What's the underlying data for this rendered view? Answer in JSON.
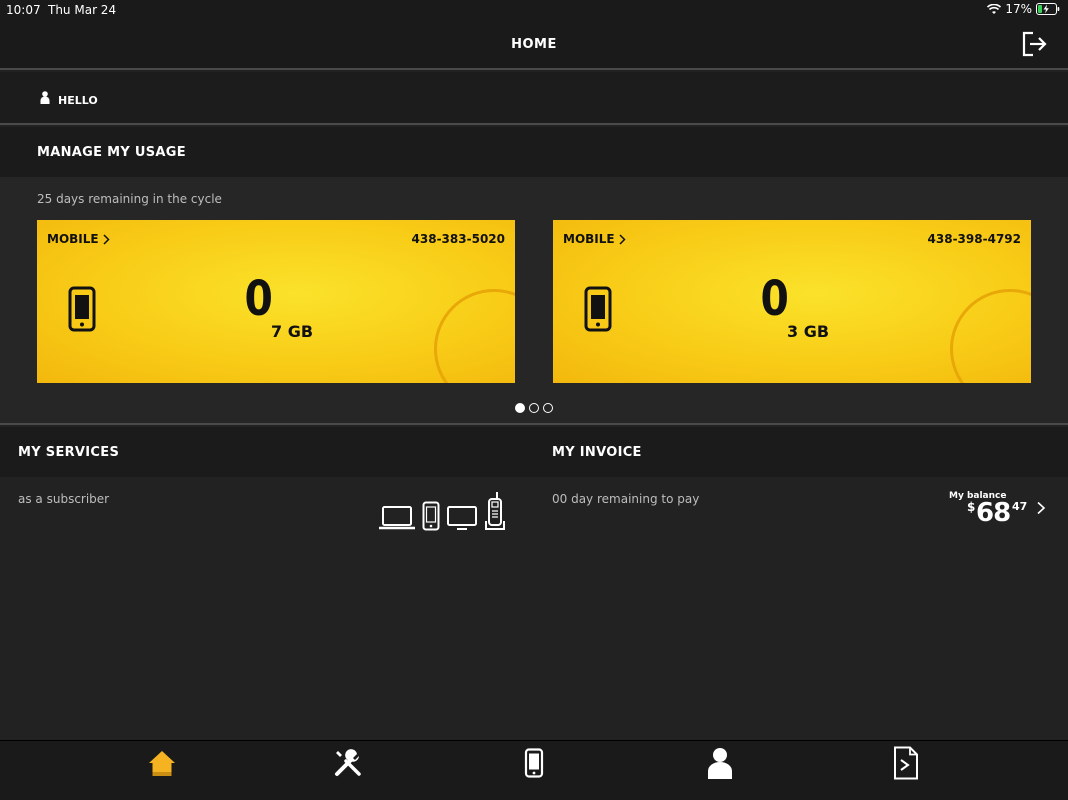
{
  "status_bar": {
    "time": "10:07",
    "date": "Thu Mar 24",
    "battery": "17%"
  },
  "header": {
    "title": "HOME"
  },
  "greeting": {
    "text": "HELLO"
  },
  "usage": {
    "title": "MANAGE MY USAGE",
    "cycle_text": "25 days remaining in the cycle",
    "cards": [
      {
        "label": "MOBILE",
        "phone": "438-383-5020",
        "used": "0",
        "total": "7 GB"
      },
      {
        "label": "MOBILE",
        "phone": "438-398-4792",
        "used": "0",
        "total": "3 GB"
      }
    ],
    "page_count": 3,
    "active_page": 0
  },
  "services": {
    "title": "MY SERVICES",
    "subtitle": "as a subscriber"
  },
  "invoice": {
    "title": "MY INVOICE",
    "subtitle": "00 day remaining to pay",
    "balance_label": "My balance",
    "currency": "$",
    "amount": "68",
    "cents": "47"
  },
  "tabbar": {
    "items": [
      "home-icon",
      "tools-icon",
      "mobile-icon",
      "profile-icon",
      "document-icon"
    ],
    "active": "home-icon"
  },
  "colors": {
    "accent": "#f9c315",
    "card_yellow": "#f8cc17",
    "active_tab": "#f5b321"
  }
}
